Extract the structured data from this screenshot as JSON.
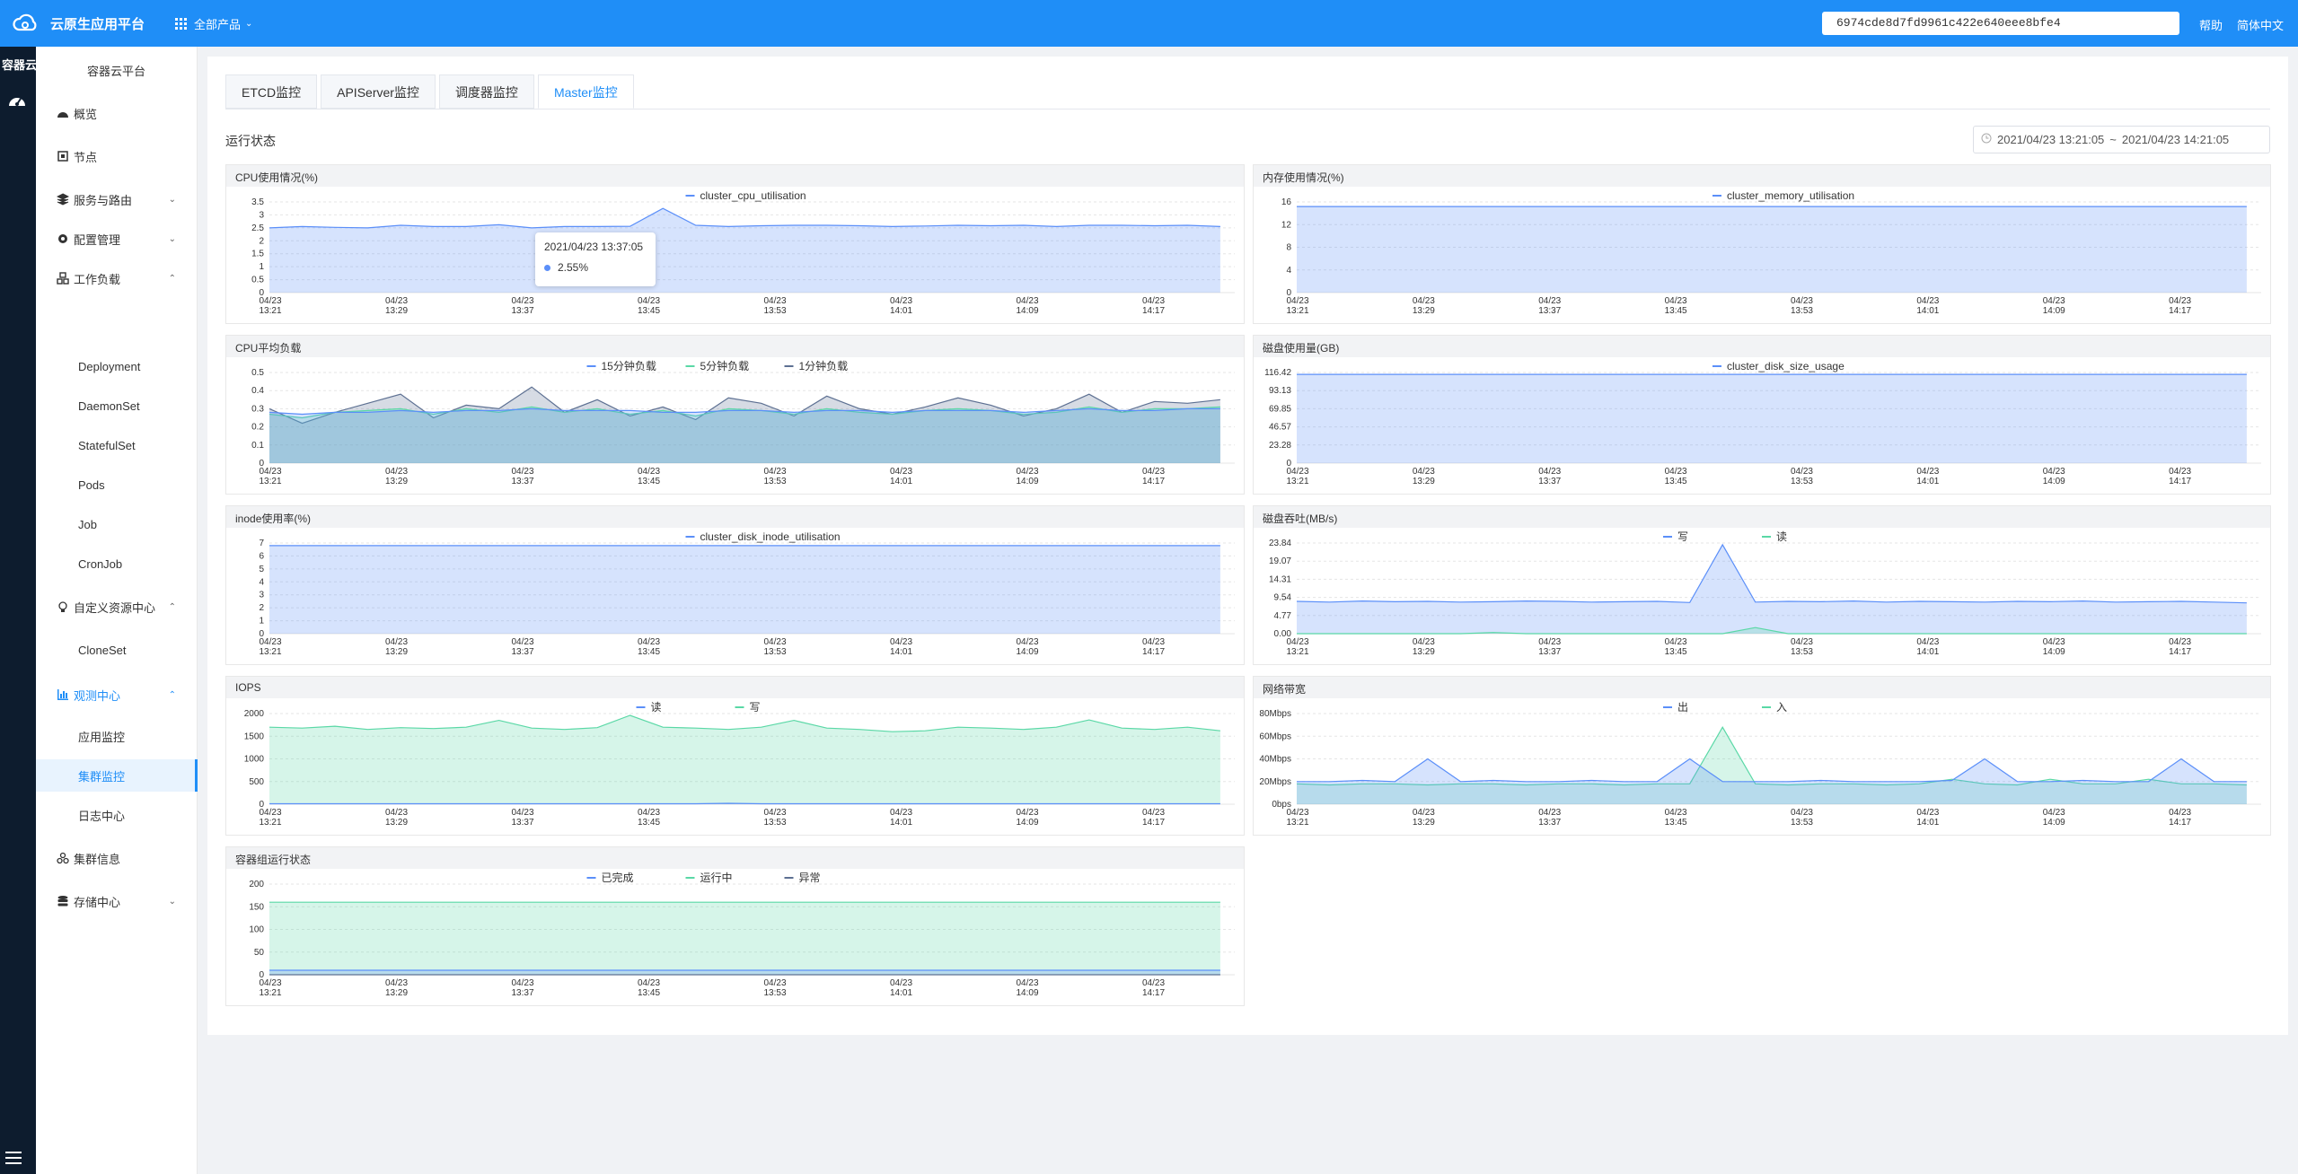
{
  "topbar": {
    "brand": "云原生应用平台",
    "products_label": "全部产品",
    "search_value": "6974cde8d7fd9961c422e640eee8bfe4",
    "help": "帮助",
    "lang": "简体中文"
  },
  "rail": {
    "title": "容器云"
  },
  "sidebar": {
    "title": "容器云平台",
    "items": [
      {
        "label": "概览",
        "icon": "dashboard-icon"
      },
      {
        "label": "节点",
        "icon": "chip-icon"
      },
      {
        "label": "服务与路由",
        "icon": "layers-icon"
      },
      {
        "label": "配置管理",
        "icon": "gear-icon"
      },
      {
        "label": "工作负载",
        "icon": "boxes-icon"
      },
      {
        "label": "自定义资源中心",
        "icon": "bulb-icon"
      },
      {
        "label": "观测中心",
        "icon": "bar-chart-icon"
      },
      {
        "label": "集群信息",
        "icon": "cluster-icon"
      },
      {
        "label": "存储中心",
        "icon": "database-icon"
      }
    ],
    "workload_sub": [
      "Deployment",
      "DaemonSet",
      "StatefulSet",
      "Pods",
      "Job",
      "CronJob"
    ],
    "crd_sub": [
      "CloneSet"
    ],
    "observe_sub": [
      "应用监控",
      "集群监控",
      "日志中心"
    ]
  },
  "tabs": [
    "ETCD监控",
    "APIServer监控",
    "调度器监控",
    "Master监控"
  ],
  "active_tab": "Master监控",
  "section_title": "运行状态",
  "date_range": {
    "start": "2021/04/23 13:21:05",
    "sep": "~",
    "end": "2021/04/23 14:21:05"
  },
  "tooltip": {
    "time": "2021/04/23 13:37:05",
    "value": "2.55%"
  },
  "colors": {
    "accent": "#1f8ef7",
    "blue_series": "#5b8ff9",
    "green_series": "#5ad8a6",
    "dark_series": "#5d7092"
  },
  "chart_data": [
    {
      "type": "area",
      "title": "CPU使用情况(%)",
      "x": [
        "04/23 13:21",
        "04/23 13:29",
        "04/23 13:37",
        "04/23 13:45",
        "04/23 13:53",
        "04/23 14:01",
        "04/23 14:09",
        "04/23 14:17"
      ],
      "ylim": [
        0,
        3.5
      ],
      "yticks": [
        "0",
        "0.5",
        "1",
        "1.5",
        "2",
        "2.5",
        "3",
        "3.5"
      ],
      "series": [
        {
          "name": "cluster_cpu_utilisation",
          "color": "#5b8ff9",
          "values": [
            2.5,
            2.55,
            2.52,
            2.5,
            2.6,
            2.55,
            2.55,
            2.62,
            2.5,
            2.55,
            2.55,
            2.56,
            3.25,
            2.6,
            2.55,
            2.58,
            2.6,
            2.6,
            2.58,
            2.55,
            2.57,
            2.6,
            2.58,
            2.6,
            2.55,
            2.6,
            2.6,
            2.58,
            2.6,
            2.55
          ]
        }
      ]
    },
    {
      "type": "area",
      "title": "内存使用情况(%)",
      "x": [
        "04/23 13:21",
        "04/23 13:29",
        "04/23 13:37",
        "04/23 13:45",
        "04/23 13:53",
        "04/23 14:01",
        "04/23 14:09",
        "04/23 14:17"
      ],
      "ylim": [
        0,
        16
      ],
      "yticks": [
        "0",
        "4",
        "8",
        "12",
        "16"
      ],
      "series": [
        {
          "name": "cluster_memory_utilisation",
          "color": "#5b8ff9",
          "values": [
            15.2,
            15.2,
            15.2,
            15.2,
            15.2,
            15.2,
            15.2,
            15.2,
            15.2,
            15.2,
            15.2,
            15.2,
            15.2,
            15.2,
            15.2,
            15.2,
            15.2,
            15.2,
            15.2,
            15.2,
            15.2,
            15.2,
            15.2,
            15.2,
            15.2,
            15.2,
            15.2,
            15.2,
            15.2,
            15.2
          ]
        }
      ]
    },
    {
      "type": "area",
      "title": "CPU平均负载",
      "x": [
        "04/23 13:21",
        "04/23 13:29",
        "04/23 13:37",
        "04/23 13:45",
        "04/23 13:53",
        "04/23 14:01",
        "04/23 14:09",
        "04/23 14:17"
      ],
      "ylim": [
        0,
        0.5
      ],
      "yticks": [
        "0",
        "0.1",
        "0.2",
        "0.3",
        "0.4",
        "0.5"
      ],
      "series": [
        {
          "name": "15分钟负载",
          "color": "#5b8ff9",
          "values": [
            0.28,
            0.27,
            0.28,
            0.28,
            0.29,
            0.28,
            0.29,
            0.29,
            0.3,
            0.29,
            0.29,
            0.29,
            0.28,
            0.28,
            0.29,
            0.29,
            0.28,
            0.29,
            0.29,
            0.28,
            0.29,
            0.29,
            0.29,
            0.28,
            0.29,
            0.3,
            0.29,
            0.29,
            0.3,
            0.3
          ]
        },
        {
          "name": "5分钟负载",
          "color": "#5ad8a6",
          "values": [
            0.27,
            0.25,
            0.28,
            0.29,
            0.3,
            0.27,
            0.3,
            0.28,
            0.31,
            0.28,
            0.3,
            0.27,
            0.29,
            0.26,
            0.3,
            0.29,
            0.27,
            0.3,
            0.28,
            0.27,
            0.29,
            0.3,
            0.29,
            0.27,
            0.28,
            0.31,
            0.28,
            0.3,
            0.3,
            0.31
          ]
        },
        {
          "name": "1分钟负载",
          "color": "#5d7092",
          "values": [
            0.3,
            0.22,
            0.28,
            0.33,
            0.38,
            0.25,
            0.32,
            0.3,
            0.42,
            0.28,
            0.35,
            0.26,
            0.31,
            0.24,
            0.36,
            0.33,
            0.26,
            0.37,
            0.3,
            0.27,
            0.31,
            0.36,
            0.32,
            0.26,
            0.3,
            0.38,
            0.28,
            0.34,
            0.33,
            0.35
          ]
        }
      ]
    },
    {
      "type": "area",
      "title": "磁盘使用量(GB)",
      "x": [
        "04/23 13:21",
        "04/23 13:29",
        "04/23 13:37",
        "04/23 13:45",
        "04/23 13:53",
        "04/23 14:01",
        "04/23 14:09",
        "04/23 14:17"
      ],
      "ylim": [
        0,
        116.42
      ],
      "yticks": [
        "0",
        "23.28",
        "46.57",
        "69.85",
        "93.13",
        "116.42"
      ],
      "series": [
        {
          "name": "cluster_disk_size_usage",
          "color": "#5b8ff9",
          "values": [
            114,
            114,
            114,
            114,
            114,
            114,
            114,
            114,
            114,
            114,
            114,
            114,
            114,
            114,
            114,
            114,
            114,
            114,
            114,
            114,
            114,
            114,
            114,
            114,
            114,
            114,
            114,
            114,
            114,
            114
          ]
        }
      ]
    },
    {
      "type": "area",
      "title": "inode使用率(%)",
      "x": [
        "04/23 13:21",
        "04/23 13:29",
        "04/23 13:37",
        "04/23 13:45",
        "04/23 13:53",
        "04/23 14:01",
        "04/23 14:09",
        "04/23 14:17"
      ],
      "ylim": [
        0,
        7
      ],
      "yticks": [
        "0",
        "1",
        "2",
        "3",
        "4",
        "5",
        "6",
        "7"
      ],
      "series": [
        {
          "name": "cluster_disk_inode_utilisation",
          "color": "#5b8ff9",
          "values": [
            6.8,
            6.8,
            6.8,
            6.8,
            6.8,
            6.8,
            6.8,
            6.8,
            6.8,
            6.8,
            6.8,
            6.8,
            6.8,
            6.8,
            6.8,
            6.8,
            6.8,
            6.8,
            6.8,
            6.8,
            6.8,
            6.8,
            6.8,
            6.8,
            6.8,
            6.8,
            6.8,
            6.8,
            6.8,
            6.8
          ]
        }
      ]
    },
    {
      "type": "area",
      "title": "磁盘吞吐(MB/s)",
      "x": [
        "04/23 13:21",
        "04/23 13:29",
        "04/23 13:37",
        "04/23 13:45",
        "04/23 13:53",
        "04/23 14:01",
        "04/23 14:09",
        "04/23 14:17"
      ],
      "ylim": [
        0,
        23.84
      ],
      "yticks": [
        "0.00",
        "4.77",
        "9.54",
        "14.31",
        "19.07",
        "23.84"
      ],
      "series": [
        {
          "name": "写",
          "color": "#5b8ff9",
          "values": [
            8.5,
            8.3,
            8.6,
            8.4,
            8.5,
            8.3,
            8.4,
            8.6,
            8.5,
            8.3,
            8.4,
            8.5,
            8.2,
            23.4,
            8.3,
            8.5,
            8.4,
            8.6,
            8.3,
            8.5,
            8.4,
            8.3,
            8.5,
            8.4,
            8.6,
            8.3,
            8.4,
            8.5,
            8.3,
            8.1
          ]
        },
        {
          "name": "读",
          "color": "#5ad8a6",
          "values": [
            0,
            0,
            0,
            0,
            0,
            0,
            0.3,
            0,
            0,
            0,
            0,
            0,
            0,
            0,
            1.6,
            0,
            0,
            0,
            0,
            0,
            0,
            0,
            0,
            0,
            0,
            0,
            0,
            0,
            0,
            0
          ]
        }
      ]
    },
    {
      "type": "area",
      "title": "IOPS",
      "x": [
        "04/23 13:21",
        "04/23 13:29",
        "04/23 13:37",
        "04/23 13:45",
        "04/23 13:53",
        "04/23 14:01",
        "04/23 14:09",
        "04/23 14:17"
      ],
      "ylim": [
        0,
        2000
      ],
      "yticks": [
        "0",
        "500",
        "1000",
        "1500",
        "2000"
      ],
      "series": [
        {
          "name": "读",
          "color": "#5b8ff9",
          "values": [
            10,
            10,
            10,
            10,
            10,
            10,
            10,
            10,
            10,
            10,
            10,
            10,
            10,
            10,
            20,
            10,
            10,
            10,
            10,
            10,
            10,
            10,
            10,
            10,
            10,
            10,
            10,
            10,
            10,
            10
          ]
        },
        {
          "name": "写",
          "color": "#5ad8a6",
          "values": [
            1700,
            1680,
            1720,
            1650,
            1690,
            1670,
            1700,
            1850,
            1680,
            1650,
            1690,
            1960,
            1700,
            1680,
            1650,
            1700,
            1850,
            1680,
            1650,
            1600,
            1620,
            1700,
            1680,
            1650,
            1700,
            1860,
            1680,
            1650,
            1700,
            1620
          ]
        }
      ]
    },
    {
      "type": "area",
      "title": "网络带宽",
      "x": [
        "04/23 13:21",
        "04/23 13:29",
        "04/23 13:37",
        "04/23 13:45",
        "04/23 13:53",
        "04/23 14:01",
        "04/23 14:09",
        "04/23 14:17"
      ],
      "ylim": [
        0,
        80
      ],
      "yticks": [
        "0bps",
        "20Mbps",
        "40Mbps",
        "60Mbps",
        "80Mbps"
      ],
      "series": [
        {
          "name": "出",
          "color": "#5b8ff9",
          "values": [
            20,
            20,
            21,
            20,
            40,
            20,
            21,
            20,
            20,
            21,
            20,
            20,
            40,
            20,
            20,
            20,
            21,
            20,
            20,
            20,
            21,
            40,
            20,
            20,
            21,
            20,
            20,
            40,
            20,
            20
          ]
        },
        {
          "name": "入",
          "color": "#5ad8a6",
          "values": [
            18,
            17,
            18,
            18,
            17,
            18,
            18,
            17,
            18,
            18,
            17,
            18,
            18,
            68,
            18,
            17,
            18,
            18,
            17,
            18,
            22,
            18,
            17,
            22,
            18,
            18,
            22,
            18,
            18,
            17
          ]
        }
      ]
    },
    {
      "type": "area",
      "title": "容器组运行状态",
      "x": [
        "04/23 13:21",
        "04/23 13:29",
        "04/23 13:37",
        "04/23 13:45",
        "04/23 13:53",
        "04/23 14:01",
        "04/23 14:09",
        "04/23 14:17"
      ],
      "ylim": [
        0,
        200
      ],
      "yticks": [
        "0",
        "50",
        "100",
        "150",
        "200"
      ],
      "series": [
        {
          "name": "已完成",
          "color": "#5b8ff9",
          "values": [
            10,
            10,
            10,
            10,
            10,
            10,
            10,
            10,
            10,
            10,
            10,
            10,
            10,
            10,
            10,
            10,
            10,
            10,
            10,
            10,
            10,
            10,
            10,
            10,
            10,
            10,
            10,
            10,
            10,
            10
          ]
        },
        {
          "name": "运行中",
          "color": "#5ad8a6",
          "values": [
            160,
            160,
            160,
            160,
            160,
            160,
            160,
            160,
            160,
            160,
            160,
            160,
            160,
            160,
            160,
            160,
            160,
            160,
            160,
            160,
            160,
            160,
            160,
            160,
            160,
            160,
            160,
            160,
            160,
            160
          ]
        },
        {
          "name": "异常",
          "color": "#5d7092",
          "values": [
            0,
            0,
            0,
            0,
            0,
            0,
            0,
            0,
            0,
            0,
            0,
            0,
            0,
            0,
            0,
            0,
            0,
            0,
            0,
            0,
            0,
            0,
            0,
            0,
            0,
            0,
            0,
            0,
            0,
            0
          ]
        }
      ]
    }
  ]
}
